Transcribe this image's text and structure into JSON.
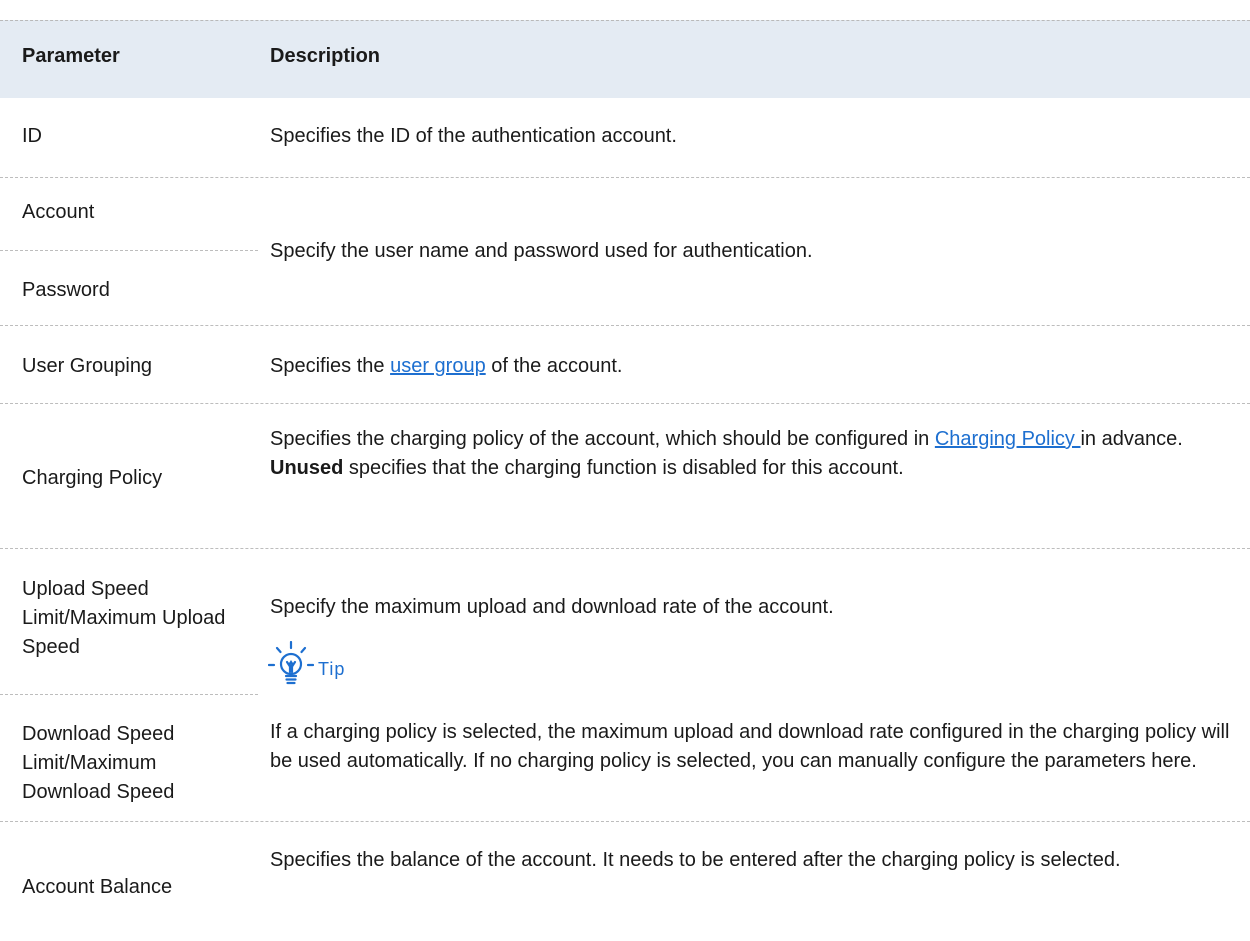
{
  "table": {
    "headers": {
      "parameter": "Parameter",
      "description": "Description"
    },
    "rows": {
      "id": {
        "param": "ID",
        "desc": "Specifies the ID of the authentication account."
      },
      "account_password": {
        "param1": "Account",
        "param2": "Password",
        "desc": "Specify the user name and password used for authentication."
      },
      "user_grouping": {
        "param": "User Grouping",
        "desc_before": "Specifies the ",
        "link": "user group",
        "desc_after": " of the account."
      },
      "charging_policy": {
        "param": "Charging Policy",
        "desc_before": "Specifies the charging policy of the account, which should be configured in ",
        "link": "Charging Policy ",
        "desc_mid": "in advance. ",
        "bold": "Unused",
        "desc_after": " specifies that the charging function is disabled for this account."
      },
      "speed": {
        "param_upload": "Upload Speed Limit/Maximum Upload Speed",
        "param_download": "Download Speed Limit/Maximum Download Speed",
        "desc": "Specify the maximum upload and download rate of the account.",
        "tip_label": "Tip",
        "tip_text": "If a charging policy is selected, the maximum upload and download rate configured in the charging policy will be used automatically. If no charging policy is selected, you can manually configure the parameters here."
      },
      "account_balance": {
        "param": "Account Balance",
        "desc": "Specifies the balance of the account. It needs to be entered after the charging policy is selected."
      }
    }
  },
  "colors": {
    "header_bg": "#e4ebf3",
    "link": "#1d6fd0",
    "divider": "#bdbdbd"
  },
  "icons": {
    "tip": "lightbulb-icon"
  }
}
